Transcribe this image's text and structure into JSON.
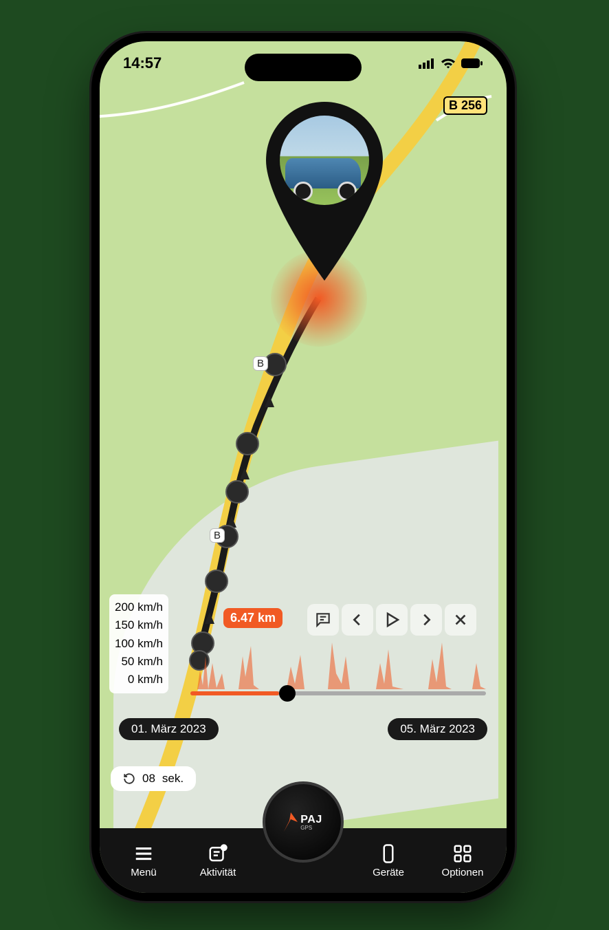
{
  "status": {
    "time": "14:57"
  },
  "map": {
    "road_sign": "B 256",
    "track_label_top": "B",
    "track_label_mid": "B"
  },
  "chart_data": {
    "type": "line",
    "ylabel": "Speed",
    "ylim": [
      0,
      200
    ],
    "yticks": [
      "200 km/h",
      "150 km/h",
      "100 km/h",
      "50 km/h",
      "0 km/h"
    ],
    "distance_badge": "6.47 km",
    "date_start": "01. März 2023",
    "date_end": "05. März 2023",
    "slider_progress_pct": 30
  },
  "refresh": {
    "value": "08",
    "unit": "sek."
  },
  "nav": {
    "logo_text": "PAJ",
    "logo_sub": "GPS",
    "items": [
      {
        "icon": "menu-icon",
        "label": "Menü"
      },
      {
        "icon": "activity-icon",
        "label": "Aktivität"
      },
      {
        "icon": "device-icon",
        "label": "Geräte"
      },
      {
        "icon": "options-icon",
        "label": "Optionen"
      }
    ]
  }
}
